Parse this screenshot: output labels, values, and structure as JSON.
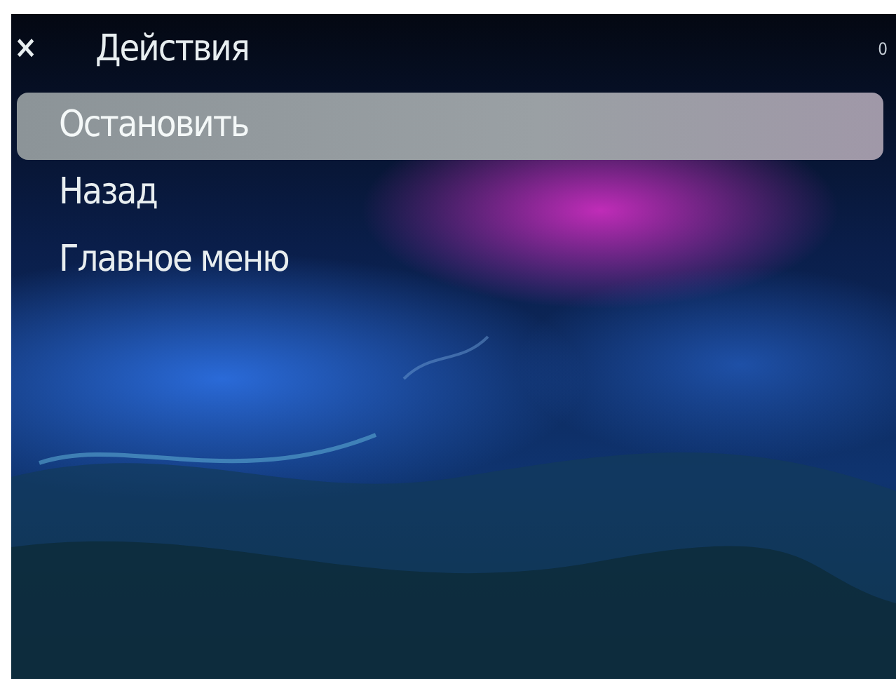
{
  "header": {
    "close_icon": "×",
    "title": "Действия",
    "counter": "0"
  },
  "menu": {
    "items": [
      {
        "label": "Остановить",
        "selected": true
      },
      {
        "label": "Назад",
        "selected": false
      },
      {
        "label": "Главное меню",
        "selected": false
      }
    ]
  }
}
